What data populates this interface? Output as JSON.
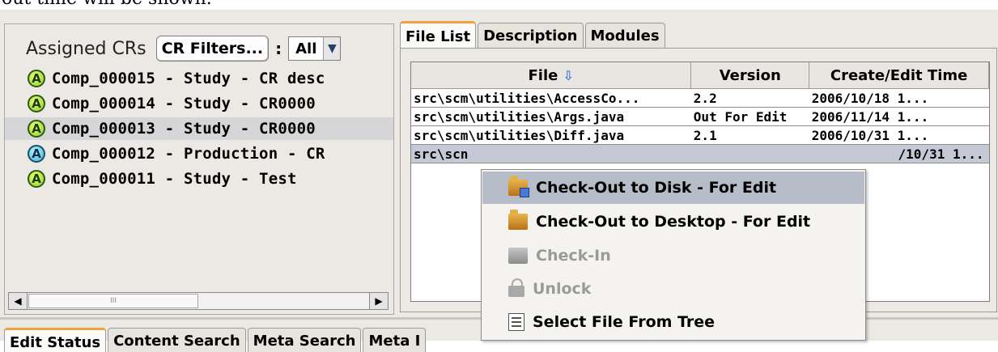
{
  "caption": "out time will be shown.",
  "left_panel": {
    "title": "Assigned CRs",
    "filters_button": "CR Filters...",
    "colon": ":",
    "filter_value": "All",
    "items": [
      {
        "badge": "A",
        "text": "Comp_000015 - Study - CR desc",
        "selected": false
      },
      {
        "badge": "A",
        "text": "Comp_000014 - Study - CR0000",
        "selected": false
      },
      {
        "badge": "A",
        "text": "Comp_000013 - Study - CR0000",
        "selected": true
      },
      {
        "badge": "A",
        "text": "Comp_000012 - Production - CR",
        "selected": false
      },
      {
        "badge": "A",
        "text": "Comp_000011 - Study - Test",
        "selected": false
      }
    ],
    "scroll_thumb_mark": "III"
  },
  "right_panel": {
    "tabs": [
      "File List",
      "Description",
      "Modules"
    ],
    "active_tab": "File List",
    "columns": [
      "File",
      "Version",
      "Create/Edit Time"
    ],
    "rows": [
      {
        "file": "src\\scm\\utilities\\AccessCo...",
        "version": "2.2",
        "time": "2006/10/18 1..."
      },
      {
        "file": "src\\scm\\utilities\\Args.java",
        "version": "Out For Edit",
        "time": "2006/11/14 1..."
      },
      {
        "file": "src\\scm\\utilities\\Diff.java",
        "version": "2.1",
        "time": "2006/10/31 1..."
      },
      {
        "file": "src\\scn",
        "version": "",
        "time": "/10/31 1..."
      }
    ]
  },
  "bottom_tabs": [
    "Edit Status",
    "Content Search",
    "Meta Search",
    "Meta I"
  ],
  "context_menu": {
    "items": [
      {
        "label": "Check-Out to Disk - For Edit",
        "icon": "checkout-disk-icon",
        "state": "hover"
      },
      {
        "label": "Check-Out to Desktop - For Edit",
        "icon": "checkout-desktop-icon",
        "state": "enabled"
      },
      {
        "label": "Check-In",
        "icon": "checkin-icon",
        "state": "disabled"
      },
      {
        "label": "Unlock",
        "icon": "unlock-icon",
        "state": "disabled"
      },
      {
        "label": "Select File From Tree",
        "icon": "select-tree-icon",
        "state": "enabled"
      }
    ]
  },
  "colors": {
    "accent_tab": "#f0a33a",
    "selection": "#c4c9d5",
    "menu_hover": "#b7bdc8",
    "sort_arrow": "#3f7fd8",
    "badge_green": "#8fcf2a",
    "badge_blue": "#3fb0d4"
  },
  "icons": {
    "sort": "sort-down-arrow-icon",
    "dropdown": "chevron-down-icon",
    "scroll_left": "scroll-left-icon",
    "scroll_right": "scroll-right-icon"
  }
}
